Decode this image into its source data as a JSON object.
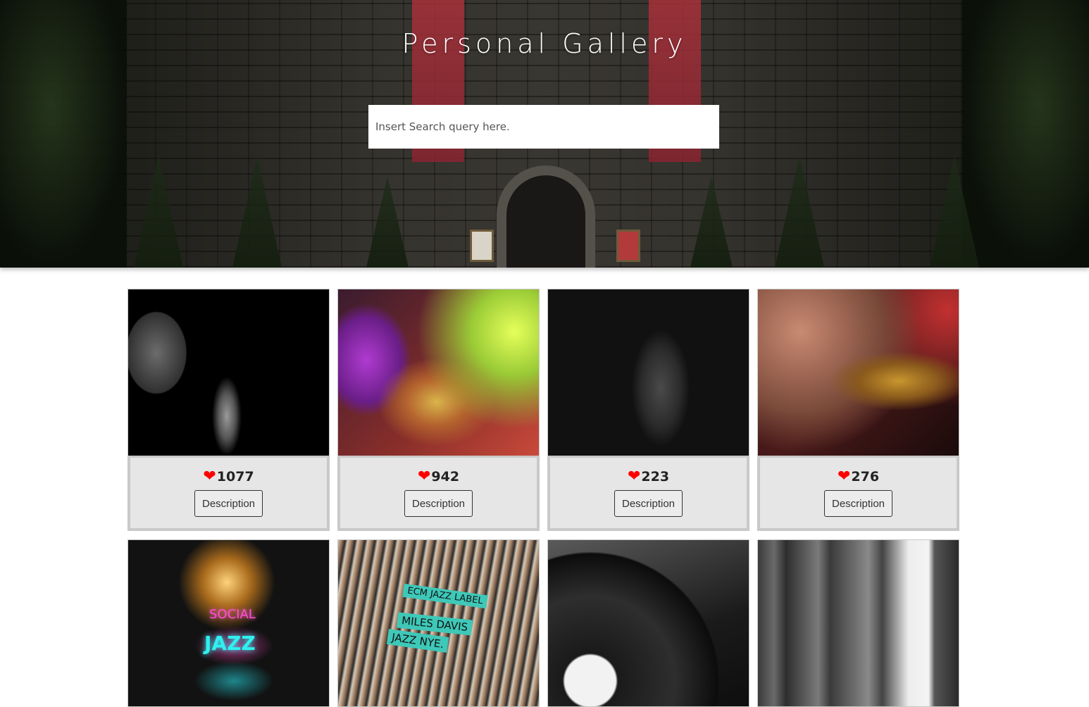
{
  "header": {
    "title": "Personal Gallery",
    "search_placeholder": "Insert Search query here."
  },
  "gallery": {
    "button_label": "Description",
    "cards": [
      {
        "likes": "1077",
        "image": "saxophone-player-bw"
      },
      {
        "likes": "942",
        "image": "saxophones-colorful"
      },
      {
        "likes": "223",
        "image": "double-bass-dark"
      },
      {
        "likes": "276",
        "image": "trumpet-closeup"
      },
      {
        "likes": null,
        "image": "social-live-jazz-neon-sign",
        "sign_line1": "SOCIAL",
        "sign_line2": "JAZZ"
      },
      {
        "likes": null,
        "image": "record-bins",
        "label1": "ECM JAZZ LABEL",
        "label2": "MILES DAVIS",
        "label3": "JAZZ NYE."
      },
      {
        "likes": null,
        "image": "vinyl-turntable"
      },
      {
        "likes": null,
        "image": "saxophonist-columns"
      }
    ]
  },
  "colors": {
    "heart": "#ff0000",
    "card_background": "#e6e6e6"
  },
  "icons": {
    "like": "heart-icon"
  }
}
